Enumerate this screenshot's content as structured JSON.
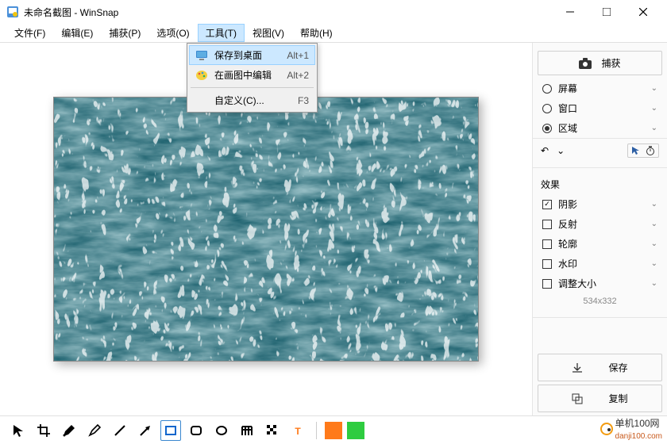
{
  "title": "未命名截图 - WinSnap",
  "menubar": [
    "文件(F)",
    "编辑(E)",
    "捕获(P)",
    "选项(O)",
    "工具(T)",
    "视图(V)",
    "帮助(H)"
  ],
  "menubar_active_index": 4,
  "dropdown": {
    "items": [
      {
        "label": "保存到桌面",
        "shortcut": "Alt+1",
        "icon": "monitor-icon",
        "highlighted": true
      },
      {
        "label": "在画图中编辑",
        "shortcut": "Alt+2",
        "icon": "palette-icon",
        "highlighted": false
      },
      {
        "label": "自定义(C)...",
        "shortcut": "F3",
        "icon": "",
        "highlighted": false
      }
    ]
  },
  "side": {
    "capture_label": "捕获",
    "capture_opts": [
      {
        "label": "屏幕",
        "checked": false
      },
      {
        "label": "窗口",
        "checked": false
      },
      {
        "label": "区域",
        "checked": true
      }
    ],
    "effects_title": "效果",
    "effects": [
      {
        "label": "阴影",
        "checked": true
      },
      {
        "label": "反射",
        "checked": false
      },
      {
        "label": "轮廓",
        "checked": false
      },
      {
        "label": "水印",
        "checked": false
      },
      {
        "label": "调整大小",
        "checked": false
      }
    ],
    "dims": "534x332",
    "save_label": "保存",
    "copy_label": "复制"
  },
  "toolbar": {
    "tools": [
      "pointer-icon",
      "crop-icon",
      "pen-icon",
      "highlighter-icon",
      "line-icon",
      "arrow-icon",
      "rect-icon",
      "rounded-rect-icon",
      "ellipse-icon",
      "blur-icon",
      "pixelate-icon",
      "text-icon"
    ],
    "selected_index": 6,
    "colors": [
      "#ff7a1a",
      "#2ecc40"
    ]
  },
  "watermark": {
    "site": "单机100网",
    "domain": "danji100.com"
  }
}
